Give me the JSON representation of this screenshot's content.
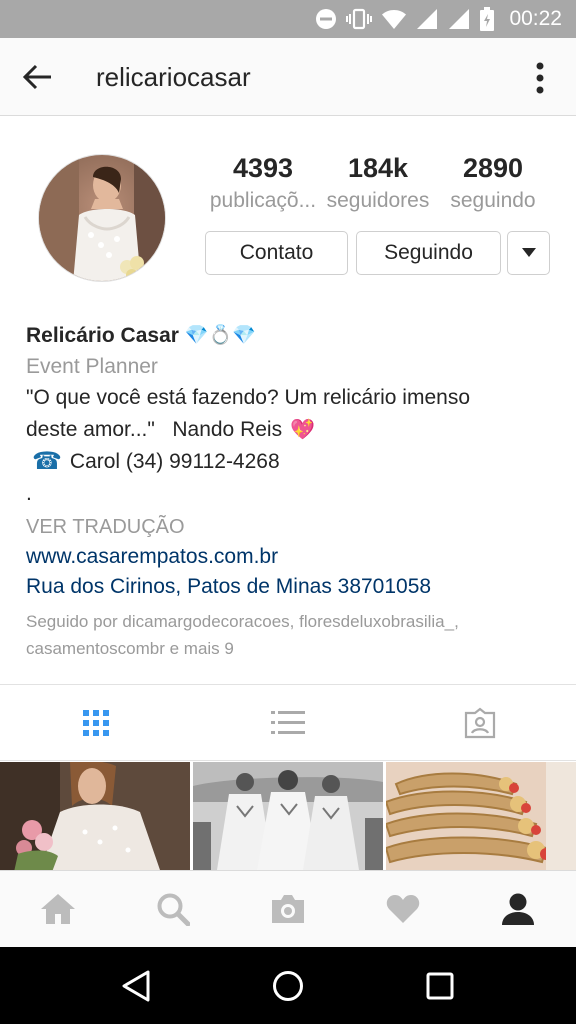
{
  "status_bar": {
    "time": "00:22"
  },
  "header": {
    "username": "relicariocasar"
  },
  "stats": [
    {
      "value": "4393",
      "label": "publicaçõ..."
    },
    {
      "value": "184k",
      "label": "seguidores"
    },
    {
      "value": "2890",
      "label": "seguindo"
    }
  ],
  "buttons": {
    "contact": "Contato",
    "following": "Seguindo"
  },
  "bio": {
    "name": "Relicário Casar",
    "name_emojis": "💎💍💎",
    "category": "Event Planner",
    "line1": "\"O que você está fazendo? Um relicário imenso",
    "line2": "deste amor...\"   Nando Reis",
    "heart": "💖",
    "phone_icon": "☎",
    "phone": "Carol (34) 99112-4268",
    "dot": ".",
    "translate": "VER TRADUÇÃO",
    "website": "www.casarempatos.com.br",
    "address": "Rua dos Cirinos, Patos de Minas 38701058",
    "followed_by_1": "Seguido por dicamargodecoracoes, floresdeluxobrasilia_,",
    "followed_by_2": "casamentoscombr e mais 9"
  },
  "tabs": [
    {
      "icon": "grid-icon",
      "active": true
    },
    {
      "icon": "list-icon",
      "active": false
    },
    {
      "icon": "tagged-icon",
      "active": false
    }
  ],
  "bottom_nav": [
    "home-icon",
    "search-icon",
    "camera-icon",
    "heart-icon",
    "profile-icon"
  ],
  "colors": {
    "accent": "#3897f0",
    "link": "#003569",
    "status_bar": "#a8a8a8"
  }
}
